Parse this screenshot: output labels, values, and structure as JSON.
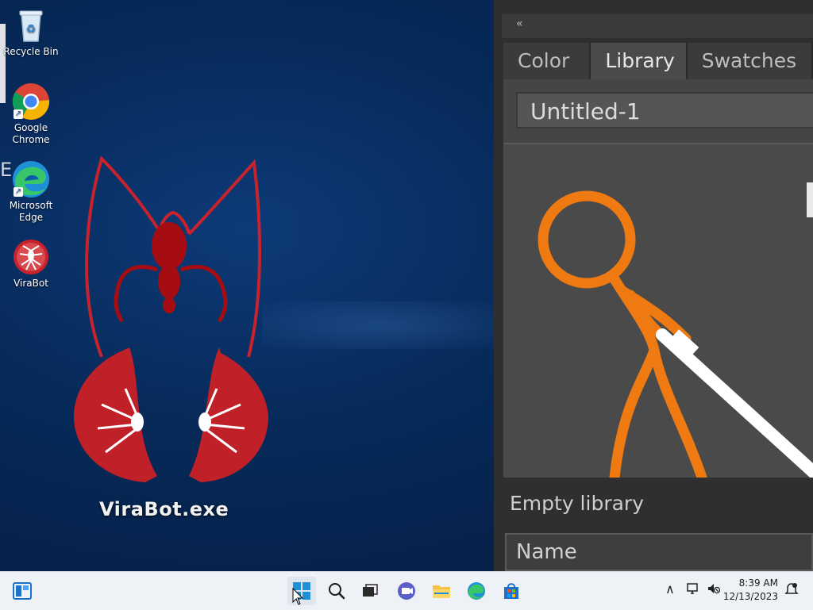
{
  "desktop": {
    "icons": [
      {
        "label": "Recycle Bin",
        "icon": "recycle-bin-icon"
      },
      {
        "label": "Google Chrome",
        "icon": "chrome-icon"
      },
      {
        "label": "Microsoft Edge",
        "icon": "edge-icon"
      },
      {
        "label": "ViraBot",
        "icon": "virabot-icon"
      }
    ],
    "big_icon_label": "ViraBot.exe",
    "edge_letter": "E"
  },
  "panel": {
    "collapse_glyph": "«",
    "tabs": [
      {
        "label": "Color"
      },
      {
        "label": "Library"
      },
      {
        "label": "Swatches"
      }
    ],
    "document_select": "Untitled-1",
    "empty_label": "Empty library",
    "name_header": "Name"
  },
  "taskbar": {
    "time": "8:39 AM",
    "date": "12/13/2023"
  },
  "colors": {
    "desktop_bg": "#072a5a",
    "panel_bg": "#2f2f2f",
    "accent_orange": "#f07a12",
    "logo_red": "#c8232c",
    "taskbar_bg": "#eef2f6"
  }
}
